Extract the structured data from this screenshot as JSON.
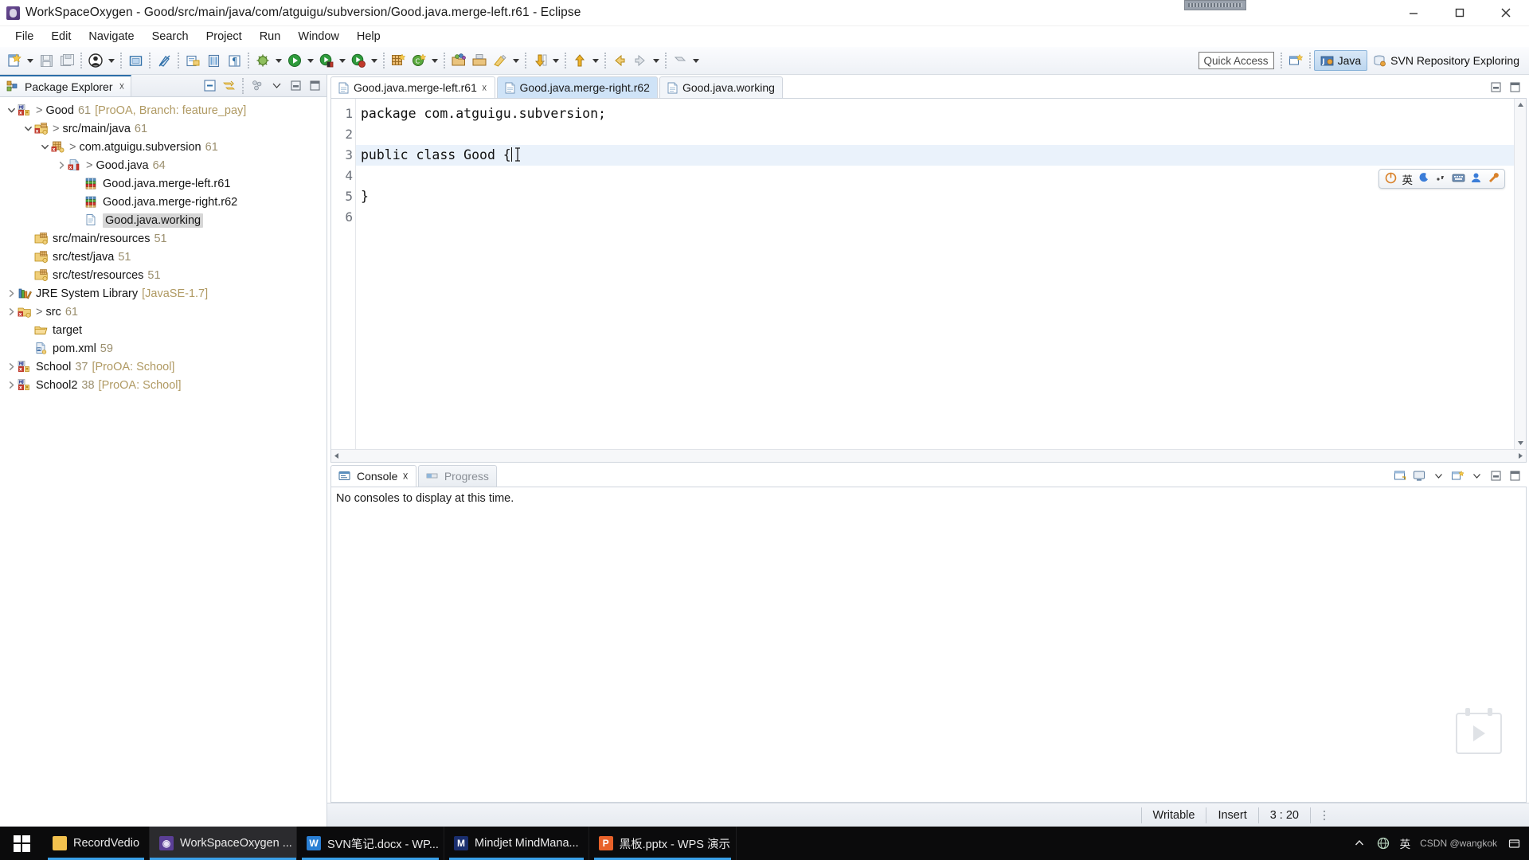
{
  "window": {
    "title": "WorkSpaceOxygen - Good/src/main/java/com/atguigu/subversion/Good.java.merge-left.r61 - Eclipse",
    "app_icon": "eclipse-icon",
    "minimize": "minimize-button",
    "maximize": "maximize-button",
    "close": "close-button"
  },
  "menubar": {
    "items": [
      "File",
      "Edit",
      "Navigate",
      "Search",
      "Project",
      "Run",
      "Window",
      "Help"
    ]
  },
  "toolbar": {
    "quick_access_placeholder": "Quick Access",
    "perspectives": [
      {
        "label": "Java",
        "icon": "java-perspective-icon",
        "active": true
      },
      {
        "label": "SVN Repository Exploring",
        "icon": "svn-repo-icon",
        "active": false
      }
    ],
    "buttons": [
      "new-wizard",
      "save",
      "save-all",
      "user-profile",
      "toggle-mark-occurrences",
      "open-type",
      "open-task",
      "format",
      "debug",
      "run",
      "run-coverage",
      "run-profile",
      "new-java-package",
      "new-java-class",
      "open-perspective",
      "svn-commit",
      "svn-update",
      "previous-annotation",
      "next-annotation",
      "back",
      "forward"
    ]
  },
  "package_explorer": {
    "tab_label": "Package Explorer",
    "tab_icon": "package-explorer-icon",
    "tools": [
      "collapse-all-icon",
      "link-with-editor-icon",
      "view-menu-icon",
      "minimize-icon",
      "maximize-icon"
    ],
    "tree": [
      {
        "indent": 0,
        "twisty": "down",
        "icon": "java-project-svn-icon",
        "gt": ">",
        "label": "Good",
        "num": "61",
        "meta": "[ProOA, Branch: feature_pay]",
        "selected": false
      },
      {
        "indent": 1,
        "twisty": "down",
        "icon": "source-folder-svn-icon",
        "gt": ">",
        "label": "src/main/java",
        "num": "61",
        "meta": "",
        "selected": false
      },
      {
        "indent": 2,
        "twisty": "down",
        "icon": "package-svn-icon",
        "gt": ">",
        "label": "com.atguigu.subversion",
        "num": "61",
        "meta": "",
        "selected": false
      },
      {
        "indent": 3,
        "twisty": "right",
        "icon": "java-file-conflict-icon",
        "gt": ">",
        "label": "Good.java",
        "num": "64",
        "meta": "",
        "selected": false
      },
      {
        "indent": 4,
        "twisty": "none",
        "icon": "merge-file-icon",
        "gt": "",
        "label": "Good.java.merge-left.r61",
        "num": "",
        "meta": "",
        "selected": false
      },
      {
        "indent": 4,
        "twisty": "none",
        "icon": "merge-file-icon",
        "gt": "",
        "label": "Good.java.merge-right.r62",
        "num": "",
        "meta": "",
        "selected": false
      },
      {
        "indent": 4,
        "twisty": "none",
        "icon": "text-file-icon",
        "gt": "",
        "label": "Good.java.working",
        "num": "",
        "meta": "",
        "selected": true
      },
      {
        "indent": 1,
        "twisty": "none",
        "icon": "source-folder-icon",
        "gt": "",
        "label": "src/main/resources",
        "num": "51",
        "meta": "",
        "selected": false
      },
      {
        "indent": 1,
        "twisty": "none",
        "icon": "source-folder-icon",
        "gt": "",
        "label": "src/test/java",
        "num": "51",
        "meta": "",
        "selected": false
      },
      {
        "indent": 1,
        "twisty": "none",
        "icon": "source-folder-icon",
        "gt": "",
        "label": "src/test/resources",
        "num": "51",
        "meta": "",
        "selected": false
      },
      {
        "indent": 0,
        "twisty": "right",
        "icon": "jre-library-icon",
        "gt": "",
        "label": "JRE System Library",
        "num": "",
        "meta": "[JavaSE-1.7]",
        "selected": false
      },
      {
        "indent": 0,
        "twisty": "right",
        "icon": "folder-svn-icon",
        "gt": ">",
        "label": "src",
        "num": "61",
        "meta": "",
        "selected": false
      },
      {
        "indent": 1,
        "twisty": "none",
        "icon": "folder-icon",
        "gt": "",
        "label": "target",
        "num": "",
        "meta": "",
        "selected": false
      },
      {
        "indent": 1,
        "twisty": "none",
        "icon": "xml-file-icon",
        "gt": "",
        "label": "pom.xml",
        "num": "59",
        "meta": "",
        "selected": false
      },
      {
        "indent": 0,
        "twisty": "right",
        "icon": "java-project-svn-icon",
        "gt": "",
        "label": "School",
        "num": "37",
        "meta": "[ProOA: School]",
        "selected": false
      },
      {
        "indent": 0,
        "twisty": "right",
        "icon": "java-project-svn-icon",
        "gt": "",
        "label": "School2",
        "num": "38",
        "meta": "[ProOA: School]",
        "selected": false
      }
    ]
  },
  "editor": {
    "tabs": [
      {
        "label": "Good.java.merge-left.r61",
        "icon": "text-file-icon",
        "active": true,
        "closable": true
      },
      {
        "label": "Good.java.merge-right.r62",
        "icon": "text-file-icon",
        "active": false,
        "closable": false
      },
      {
        "label": "Good.java.working",
        "icon": "text-file-icon",
        "active": false,
        "closable": false
      }
    ],
    "line_numbers": [
      "1",
      "2",
      "3",
      "4",
      "5",
      "6"
    ],
    "lines": [
      {
        "no": "1",
        "text": "package com.atguigu.subversion;",
        "current": false
      },
      {
        "no": "2",
        "text": "",
        "current": false
      },
      {
        "no": "3",
        "text": "public class Good {",
        "current": true
      },
      {
        "no": "4",
        "text": "",
        "current": false
      },
      {
        "no": "5",
        "text": "}",
        "current": false
      },
      {
        "no": "6",
        "text": "",
        "current": false
      }
    ],
    "minimize_icon": "minimize-icon",
    "maximize_icon": "maximize-icon"
  },
  "ime": {
    "power_icon": "ime-power-icon",
    "mode_label": "英",
    "moon_icon": "ime-moon-icon",
    "punct_icon": "ime-punctuation-icon",
    "keyboard_icon": "ime-keyboard-icon",
    "user_icon": "ime-user-icon",
    "tools_icon": "ime-tools-icon"
  },
  "console": {
    "tabs": [
      {
        "label": "Console",
        "icon": "console-icon",
        "active": true,
        "closable": true
      },
      {
        "label": "Progress",
        "icon": "progress-icon",
        "active": false,
        "closable": false
      }
    ],
    "message": "No consoles to display at this time.",
    "tools": [
      "open-console-icon",
      "display-selected-console-icon",
      "pin-console-icon",
      "new-console-view-icon",
      "minimize-icon",
      "maximize-icon"
    ]
  },
  "statusbar": {
    "writable": "Writable",
    "insert": "Insert",
    "position": "3 : 20"
  },
  "taskbar": {
    "start_icon": "windows-start-icon",
    "items": [
      {
        "label": "RecordVedio",
        "icon": "folder-icon",
        "color": "#f2c14e",
        "active": false,
        "underline": true
      },
      {
        "label": "WorkSpaceOxygen ...",
        "icon": "eclipse-icon",
        "color": "#5b3f96",
        "active": true,
        "underline": false
      },
      {
        "label": "SVN笔记.docx - WP...",
        "icon": "wps-word-icon",
        "color": "#2a7fd4",
        "active": false,
        "underline": true
      },
      {
        "label": "Mindjet MindMana...",
        "icon": "mindjet-icon",
        "color": "#1a2e6e",
        "active": false,
        "underline": true
      },
      {
        "label": "黑板.pptx - WPS 演示",
        "icon": "wps-ppt-icon",
        "color": "#e8622a",
        "active": false,
        "underline": true
      }
    ],
    "tray": {
      "chevron": "show-hidden-icons",
      "network": "network-icon",
      "ime_label": "英",
      "watermark": "CSDN @wangkok"
    }
  }
}
